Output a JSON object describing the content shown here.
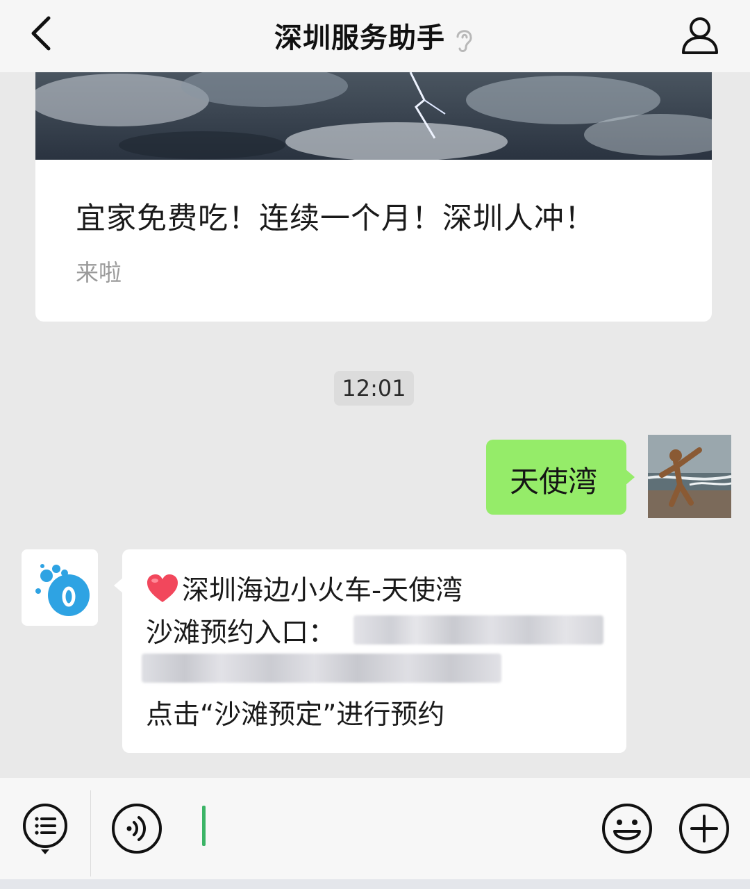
{
  "header": {
    "title": "深圳服务助手",
    "back_icon": "chevron-left-icon",
    "profile_icon": "person-icon",
    "ear_icon": "ear-icon"
  },
  "article_card": {
    "title": "宜家免费吃！连续一个月！深圳人冲！",
    "digest": "来啦"
  },
  "timestamp": "12:01",
  "messages": [
    {
      "direction": "out",
      "text": "天使湾"
    },
    {
      "direction": "in",
      "line1": "深圳海边小火车-天使湾",
      "line2": "沙滩预约入口：",
      "line4": "点击“沙滩预定”进行预约"
    }
  ],
  "input_bar": {
    "menu_icon": "list-menu-icon",
    "voice_icon": "voice-icon",
    "emoji_icon": "smiley-icon",
    "plus_icon": "plus-icon"
  },
  "colors": {
    "outgoing_bubble": "#95ec69",
    "chat_background": "#e9e9e9",
    "caret": "#3bb466"
  }
}
